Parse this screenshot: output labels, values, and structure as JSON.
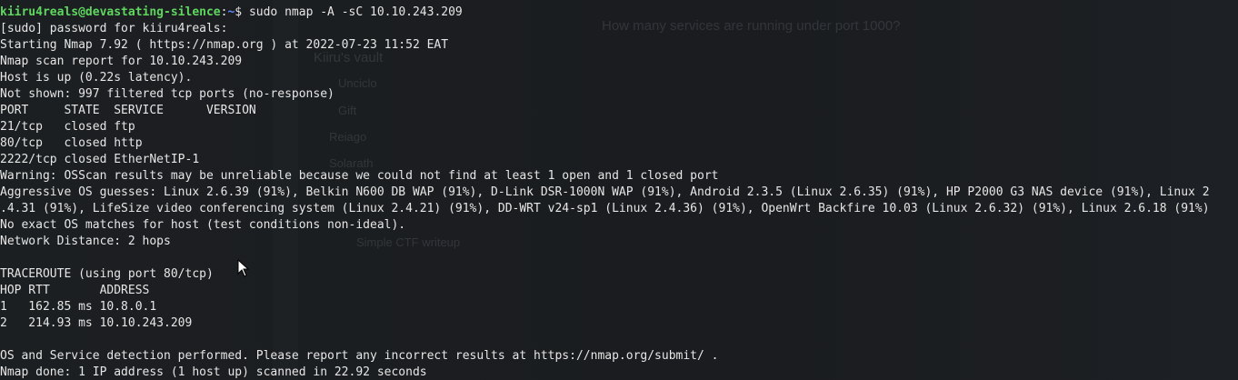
{
  "background_window": {
    "question": "How many services are running under port 1000?",
    "vault_title": "Kiiru's vault",
    "items": [
      "Unciclo",
      "Gift",
      "Reiago",
      "Solarath"
    ],
    "writeup": "Simple CTF writeup"
  },
  "terminal": {
    "prompt": {
      "user_host": "kiiru4reals@devastating-silence",
      "separator": ":",
      "path": "~",
      "symbol": "$ ",
      "command": "sudo nmap -A -sC 10.10.243.209"
    },
    "lines": [
      "[sudo] password for kiiru4reals:",
      "Starting Nmap 7.92 ( https://nmap.org ) at 2022-07-23 11:52 EAT",
      "Nmap scan report for 10.10.243.209",
      "Host is up (0.22s latency).",
      "Not shown: 997 filtered tcp ports (no-response)",
      "PORT     STATE  SERVICE      VERSION",
      "21/tcp   closed ftp",
      "80/tcp   closed http",
      "2222/tcp closed EtherNetIP-1",
      "Warning: OSScan results may be unreliable because we could not find at least 1 open and 1 closed port",
      "Aggressive OS guesses: Linux 2.6.39 (91%), Belkin N600 DB WAP (91%), D-Link DSR-1000N WAP (91%), Android 2.3.5 (Linux 2.6.35) (91%), HP P2000 G3 NAS device (91%), Linux 2",
      ".4.31 (91%), LifeSize video conferencing system (Linux 2.4.21) (91%), DD-WRT v24-sp1 (Linux 2.4.36) (91%), OpenWrt Backfire 10.03 (Linux 2.6.32) (91%), Linux 2.6.18 (91%)",
      "No exact OS matches for host (test conditions non-ideal).",
      "Network Distance: 2 hops",
      "",
      "TRACEROUTE (using port 80/tcp)",
      "HOP RTT       ADDRESS",
      "1   162.85 ms 10.8.0.1",
      "2   214.93 ms 10.10.243.209",
      "",
      "OS and Service detection performed. Please report any incorrect results at https://nmap.org/submit/ .",
      "Nmap done: 1 IP address (1 host up) scanned in 22.92 seconds"
    ]
  }
}
